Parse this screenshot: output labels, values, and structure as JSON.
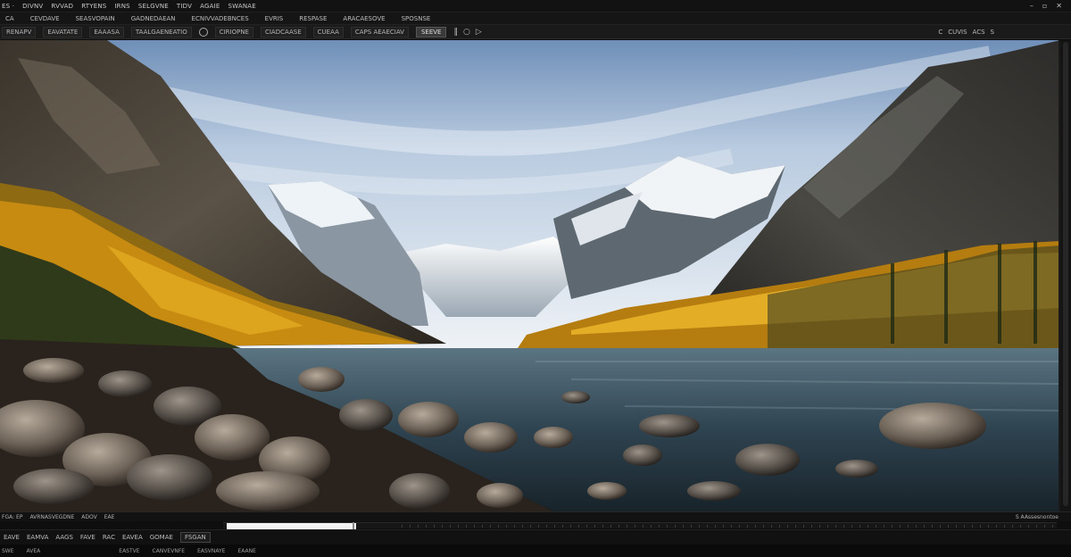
{
  "menu": {
    "items": [
      "ES ·",
      "DIVNV",
      "RVVAD",
      "RTYENS",
      "IRNS",
      "SELGVNE",
      "TIDV",
      "AGAIE",
      "SWANAE"
    ],
    "right_icons": [
      "window-min-icon",
      "window-max-icon",
      "window-close-icon"
    ]
  },
  "tabs": {
    "items": [
      "CA",
      "CEVDAVE",
      "SEASVOPAIN",
      "GADNEDAEAN",
      "ECNIVVADEBNCES",
      "EVRIS",
      "RESPASE",
      "ARACAESOVE",
      "SPOSNSE"
    ]
  },
  "options": {
    "items": [
      "RENAPV",
      "EAVATATE",
      "EAAASA",
      "TAALGAENEATIO",
      "CIRIOPNE",
      "CIADCAASE",
      "CUEAA",
      "CAPS AEAECIAV"
    ],
    "active_tool": "SEEVE",
    "right_items": [
      "C",
      "CUVIS",
      "ACS",
      "S"
    ]
  },
  "status": {
    "left": [
      "FGA: EP",
      "AVRNASVEGDNE",
      "ADOV",
      "EAE"
    ],
    "right": "S AAssesnontoe"
  },
  "timeline": {
    "progress": 0.155
  },
  "toolbar": {
    "items": [
      "EAVE",
      "EAMVA",
      "AAGS",
      "FAVE",
      "RAC",
      "EAVEA",
      "GOMAE"
    ],
    "selected": "FSGAN"
  },
  "footer": {
    "items": [
      "SWE",
      "AVEA",
      "EASTVE",
      "CANVEVNFE",
      "EASVNAYE",
      "EAANE"
    ]
  },
  "colors": {
    "accent": "#f3f3f3",
    "panel": "#1a1a1a",
    "background": "#0b0b0b"
  }
}
